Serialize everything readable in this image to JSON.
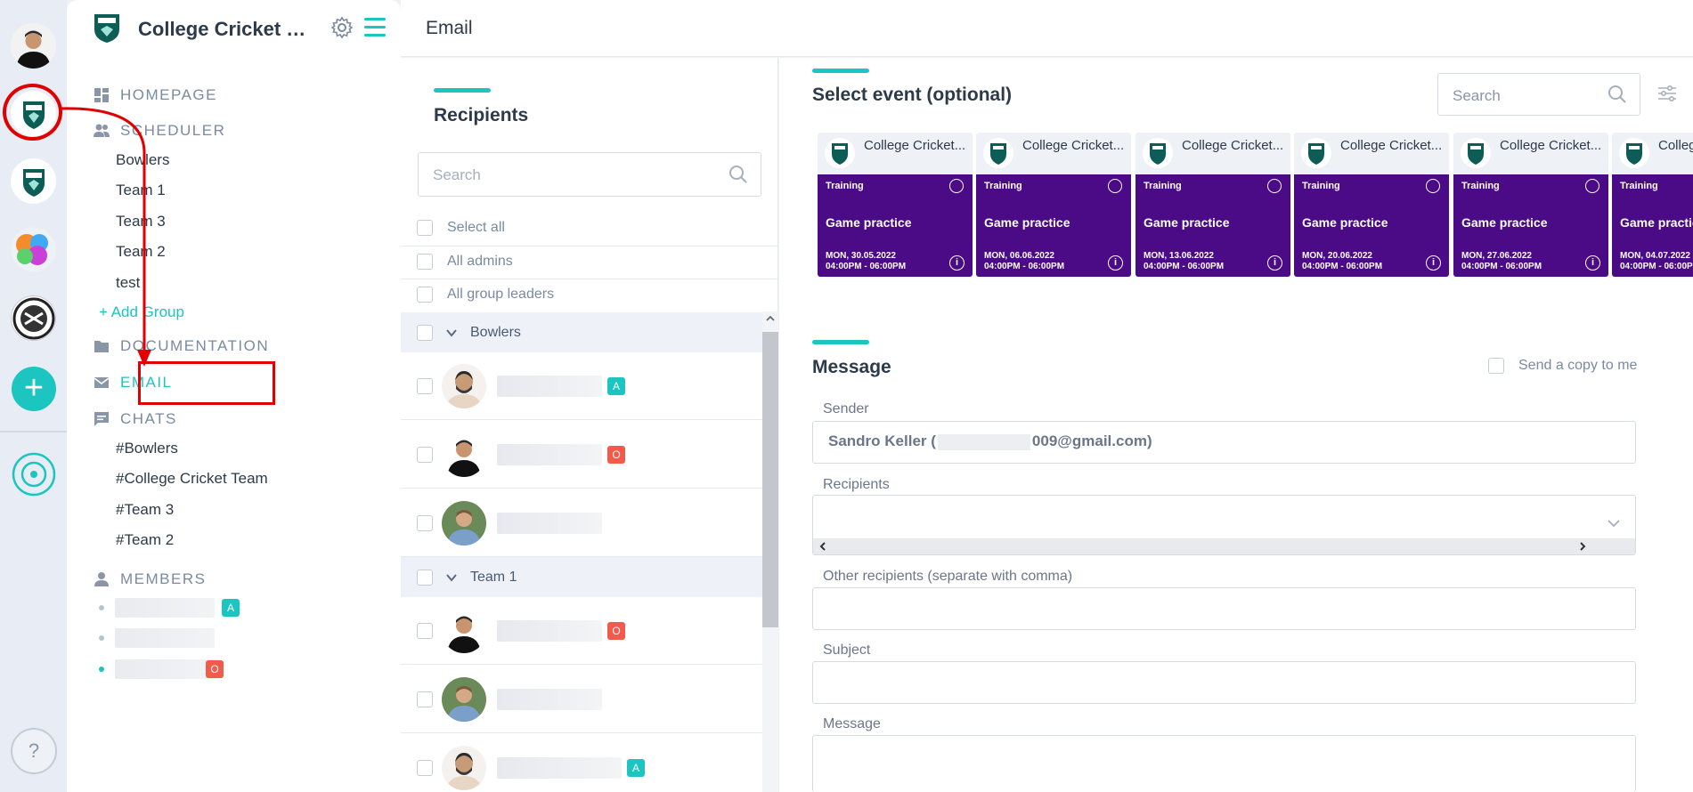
{
  "app": {
    "team_name": "College Cricket Team",
    "page_title": "Email"
  },
  "sidebar": {
    "sections": {
      "homepage": "HOMEPAGE",
      "scheduler": "SCHEDULER",
      "documentation": "DOCUMENTATION",
      "email": "EMAIL",
      "chats": "CHATS",
      "members": "MEMBERS"
    },
    "groups": [
      "Bowlers",
      "Team 1",
      "Team 3",
      "Team 2",
      "test"
    ],
    "add_group": "+ Add Group",
    "chats": [
      "#Bowlers",
      "#College Cricket Team",
      "#Team 3",
      "#Team 2"
    ],
    "members": [
      {
        "badge": "A"
      },
      {
        "badge": ""
      },
      {
        "badge": "O"
      }
    ]
  },
  "recipients": {
    "title": "Recipients",
    "search_placeholder": "Search",
    "options": [
      "Select all",
      "All admins",
      "All group leaders"
    ],
    "groups": [
      {
        "name": "Bowlers",
        "people": [
          {
            "badge": "A"
          },
          {
            "badge": "O"
          },
          {
            "badge": ""
          }
        ]
      },
      {
        "name": "Team 1",
        "people": [
          {
            "badge": "O"
          },
          {
            "badge": ""
          },
          {
            "badge": "A"
          }
        ]
      }
    ]
  },
  "events": {
    "title": "Select event (optional)",
    "search_placeholder": "Search",
    "items": [
      {
        "team": "College Cricket...",
        "type": "Training",
        "name": "Game practice",
        "date": "MON, 30.05.2022",
        "time": "04:00PM - 06:00PM"
      },
      {
        "team": "College Cricket...",
        "type": "Training",
        "name": "Game practice",
        "date": "MON, 06.06.2022",
        "time": "04:00PM - 06:00PM"
      },
      {
        "team": "College Cricket...",
        "type": "Training",
        "name": "Game practice",
        "date": "MON, 13.06.2022",
        "time": "04:00PM - 06:00PM"
      },
      {
        "team": "College Cricket...",
        "type": "Training",
        "name": "Game practice",
        "date": "MON, 20.06.2022",
        "time": "04:00PM - 06:00PM"
      },
      {
        "team": "College Cricket...",
        "type": "Training",
        "name": "Game practice",
        "date": "MON, 27.06.2022",
        "time": "04:00PM - 06:00PM"
      },
      {
        "team": "College Cricket...",
        "type": "Training",
        "name": "Game practice",
        "date": "MON, 04.07.2022",
        "time": "04:00PM - 06:00PM"
      }
    ],
    "info_glyph": "i"
  },
  "message": {
    "title": "Message",
    "send_copy": "Send a copy to me",
    "sender_label": "Sender",
    "sender_name": "Sandro Keller (",
    "sender_email_tail": "009@gmail.com)",
    "recipients_label": "Recipients",
    "other_label": "Other recipients (separate with comma)",
    "subject_label": "Subject",
    "message_label": "Message"
  },
  "rail": {
    "help": "?",
    "add": "+"
  },
  "colors": {
    "accent": "#1cc5bf",
    "event_purple": "#4b0a86",
    "annotation_red": "#e10000",
    "badge_admin": "#1cc5bf",
    "badge_owner": "#f25a4a"
  }
}
